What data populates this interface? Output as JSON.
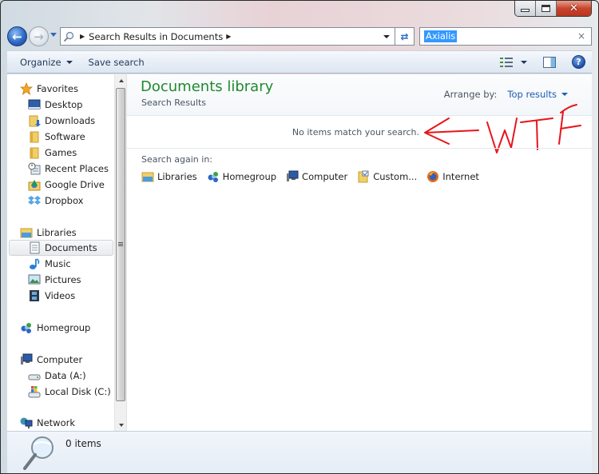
{
  "window": {
    "caption": {
      "minimize": "minimize",
      "maximize": "maximize",
      "close": "✕"
    }
  },
  "navbar": {
    "breadcrumb": [
      "Search Results in Documents"
    ],
    "search": {
      "value": "Axialis",
      "clear": "×"
    }
  },
  "toolbar": {
    "organize_label": "Organize",
    "save_search_label": "Save search",
    "help": "?"
  },
  "sidebar": {
    "favorites": {
      "label": "Favorites",
      "items": [
        {
          "label": "Desktop",
          "icon": "desktop-icon"
        },
        {
          "label": "Downloads",
          "icon": "downloads-icon"
        },
        {
          "label": "Software",
          "icon": "folder-icon"
        },
        {
          "label": "Games",
          "icon": "folder-icon"
        },
        {
          "label": "Recent Places",
          "icon": "recent-places-icon"
        },
        {
          "label": "Google Drive",
          "icon": "google-drive-icon"
        },
        {
          "label": "Dropbox",
          "icon": "dropbox-icon"
        }
      ]
    },
    "libraries": {
      "label": "Libraries",
      "items": [
        {
          "label": "Documents",
          "icon": "documents-icon",
          "selected": true
        },
        {
          "label": "Music",
          "icon": "music-icon"
        },
        {
          "label": "Pictures",
          "icon": "pictures-icon"
        },
        {
          "label": "Videos",
          "icon": "videos-icon"
        }
      ]
    },
    "homegroup": {
      "label": "Homegroup"
    },
    "computer": {
      "label": "Computer",
      "items": [
        {
          "label": "Data (A:)",
          "icon": "drive-icon"
        },
        {
          "label": "Local Disk (C:)",
          "icon": "system-drive-icon"
        }
      ]
    },
    "network": {
      "label": "Network"
    }
  },
  "content": {
    "library_title": "Documents library",
    "library_subtitle": "Search Results",
    "arrange_label": "Arrange by:",
    "arrange_value": "Top results",
    "empty_message": "No items match your search.",
    "annotation": "WTF",
    "search_again_label": "Search again in:",
    "search_again": [
      {
        "label": "Libraries",
        "icon": "libraries-icon"
      },
      {
        "label": "Homegroup",
        "icon": "homegroup-icon"
      },
      {
        "label": "Computer",
        "icon": "computer-icon"
      },
      {
        "label": "Custom...",
        "icon": "custom-icon"
      },
      {
        "label": "Internet",
        "icon": "internet-icon"
      }
    ]
  },
  "details": {
    "count": "0 items"
  },
  "colors": {
    "title_green": "#1e8a2f",
    "link_blue": "#1c5cb2",
    "annotation_red": "#e8141a",
    "selection_blue": "#3399ff"
  }
}
